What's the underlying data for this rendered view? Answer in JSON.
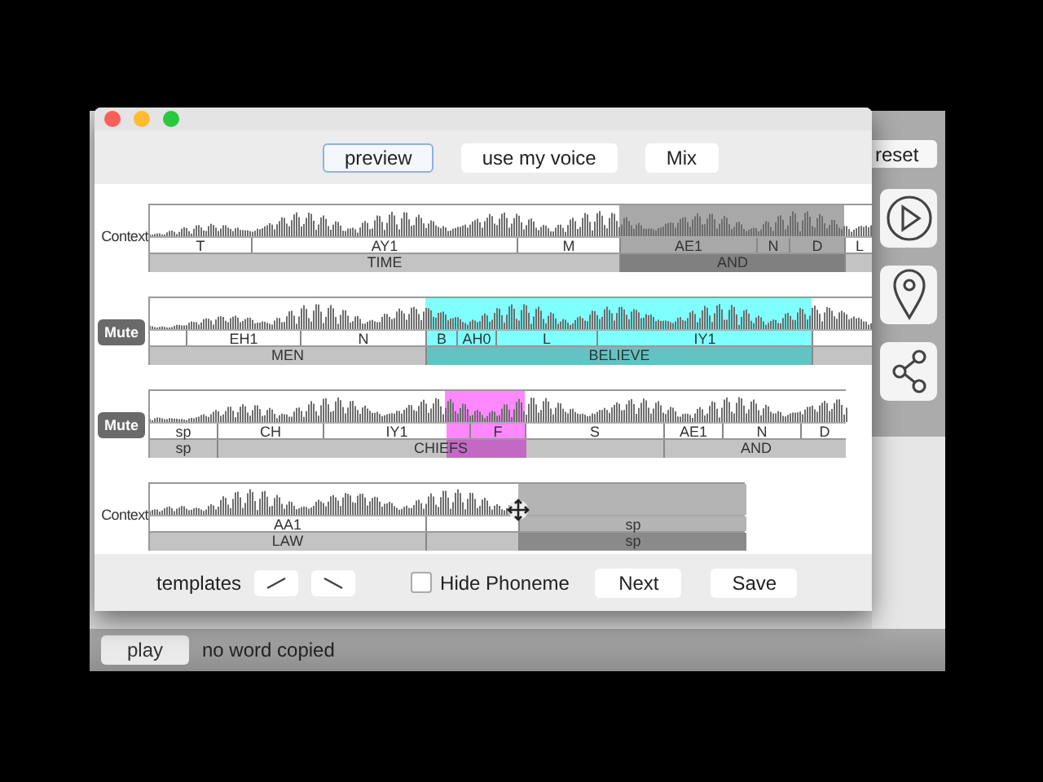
{
  "back_window": {
    "reset_button": "reset",
    "play_button": "play",
    "status": "no word copied"
  },
  "editor": {
    "toolbar": [
      {
        "label": "preview",
        "selected": true
      },
      {
        "label": "use my voice",
        "selected": false
      },
      {
        "label": "Mix",
        "selected": false
      }
    ],
    "tracks": [
      {
        "control": {
          "kind": "context",
          "label": "Context"
        },
        "phonemes": [
          "T",
          "AY1",
          "M",
          "AE1",
          "N",
          "D",
          "L"
        ],
        "words": [
          "TIME",
          "AND"
        ],
        "selection": {
          "color": "#a8a8a8"
        }
      },
      {
        "control": {
          "kind": "mute",
          "label": "Mute"
        },
        "phonemes": [
          "EH1",
          "N",
          "B",
          "AH0",
          "L",
          "IY1"
        ],
        "words": [
          "MEN",
          "BELIEVE"
        ],
        "selection": {
          "color": "#80ffff"
        }
      },
      {
        "control": {
          "kind": "mute",
          "label": "Mute"
        },
        "phonemes": [
          "sp",
          "CH",
          "IY1",
          "F",
          "S",
          "AE1",
          "N",
          "D"
        ],
        "words": [
          "sp",
          "CHIEFS",
          "AND"
        ],
        "selection": {
          "color": "#ff88ff"
        }
      },
      {
        "control": {
          "kind": "context",
          "label": "Context"
        },
        "phonemes": [
          "AA1",
          "sp"
        ],
        "words": [
          "LAW",
          "sp"
        ],
        "selection": {
          "color": "#b4b4b4"
        }
      }
    ],
    "bottom": {
      "templates_label": "templates",
      "hide_phoneme": {
        "label": "Hide Phoneme",
        "checked": false
      },
      "buttons": [
        "Next",
        "Save"
      ]
    }
  }
}
